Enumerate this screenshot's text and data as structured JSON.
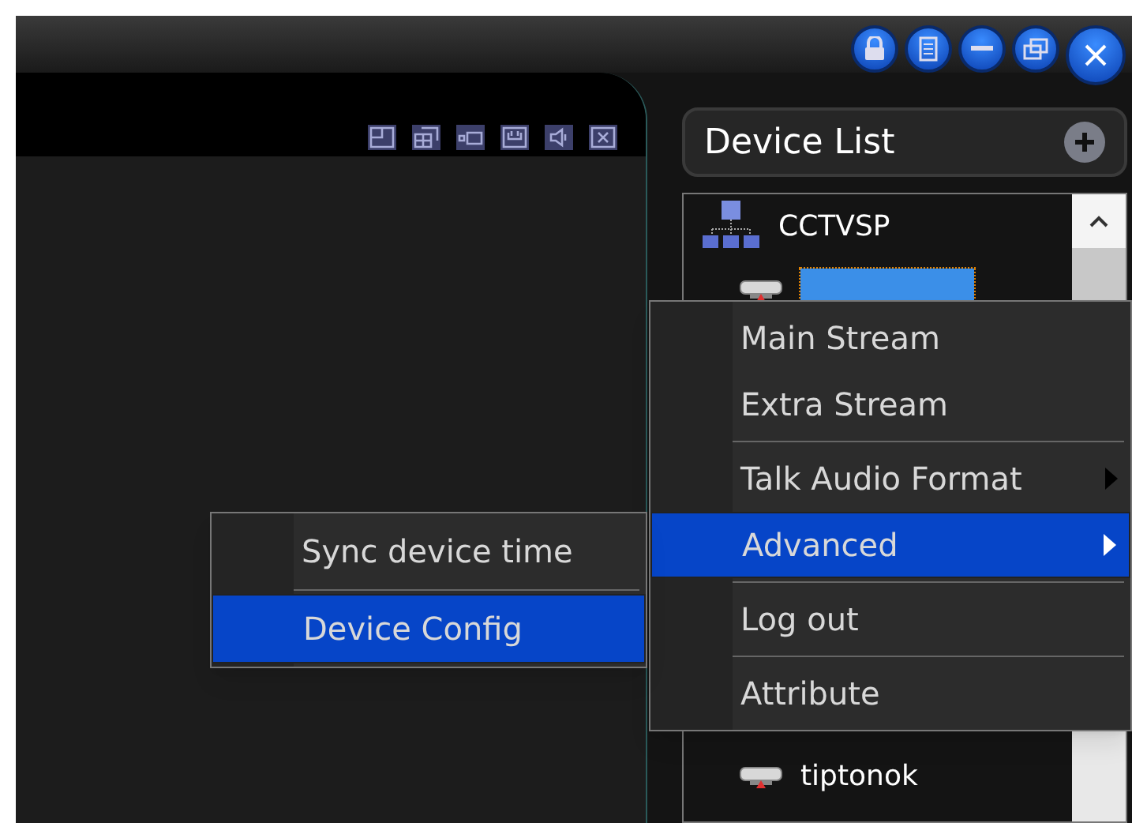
{
  "device_list": {
    "title": "Device List",
    "tree": [
      {
        "label": "CCTVSP",
        "kind": "group",
        "children": [
          {
            "kind": "device",
            "selected": true
          },
          {
            "label": "tiptonok",
            "kind": "device",
            "selected": false
          }
        ]
      }
    ]
  },
  "context_menu": {
    "items": [
      {
        "label": "Main Stream",
        "submenu": false,
        "selected": false,
        "separator_before": false
      },
      {
        "label": "Extra Stream",
        "submenu": false,
        "selected": false,
        "separator_before": false
      },
      {
        "label": "Talk Audio Format",
        "submenu": true,
        "selected": false,
        "separator_before": true
      },
      {
        "label": "Advanced",
        "submenu": true,
        "selected": true,
        "separator_before": false
      },
      {
        "label": "Log out",
        "submenu": false,
        "selected": false,
        "separator_before": true
      },
      {
        "label": "Attribute",
        "submenu": false,
        "selected": false,
        "separator_before": true
      }
    ]
  },
  "submenu": {
    "items": [
      {
        "label": "Sync device time",
        "selected": false,
        "separator_before": false
      },
      {
        "label": "Device Config",
        "selected": true,
        "separator_before": true
      }
    ]
  }
}
